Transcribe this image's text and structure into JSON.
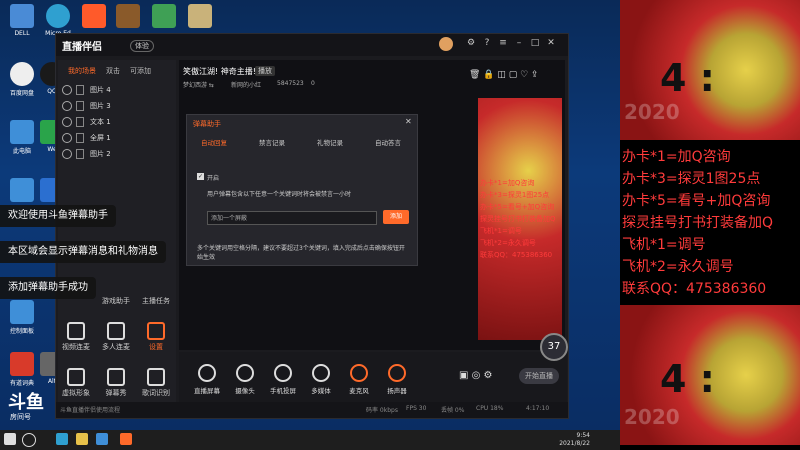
{
  "desktop": {
    "icons": [
      "DELL",
      "Micro Ed",
      "",
      "",
      "",
      "",
      "",
      "百度网盘",
      "QQ",
      "此电脑",
      "We",
      "",
      "",
      "控制面板",
      "有道词典",
      "Alt"
    ]
  },
  "app": {
    "brand": "直播伴侣",
    "tag": "体验",
    "left_tabs": [
      "我的场景",
      "双击",
      "可添加"
    ],
    "sources": [
      {
        "label": "图片 4"
      },
      {
        "label": "图片 3"
      },
      {
        "label": "文本 1"
      },
      {
        "label": "全屏 1"
      },
      {
        "label": "图片 2"
      }
    ],
    "tools": [
      {
        "label": "游戏助手"
      },
      {
        "label": "主播任务"
      },
      {
        "label": "视频连麦"
      },
      {
        "label": "多人连麦"
      },
      {
        "label": "设置"
      },
      {
        "label": "虚拟形象"
      },
      {
        "label": "弹幕秀"
      },
      {
        "label": "歌词识别"
      }
    ],
    "preview_title": "笑傲江湖! 神奇主播!",
    "preview_badge": "播放",
    "preview_meta": [
      "梦幻西游 ⇆",
      "新网的小红",
      "5847523",
      "0"
    ],
    "dialog": {
      "title": "弹幕助手",
      "tabs": [
        "自动回复",
        "禁言记录",
        "礼物记录",
        "自动答言"
      ],
      "checkbox_label": "开启",
      "desc": "用户弹幕包含以下任意一个关键词时将会被禁言一小时",
      "input_placeholder": "添加一个屏蔽",
      "add_button": "添加",
      "footer": "多个关键词用空格分隔，建议不要超过3个关键词，填入完成后点击确保按钮开始生效"
    },
    "bottom_buttons": [
      "直播屏幕",
      "摄像头",
      "手机投屏",
      "多媒体",
      "麦克风",
      "扬声器"
    ],
    "go_live": "开始直播",
    "status_bar": "斗鱼直播伴侣使用流程",
    "stats": [
      "码率 0kbps",
      "FPS 30",
      "丢帧 0%",
      "CPU 18%",
      "4:17:10"
    ]
  },
  "toasts": [
    "欢迎使用斗鱼弹幕助手",
    "本区域会显示弹幕消息和礼物消息",
    "添加弹幕助手成功"
  ],
  "logo": {
    "main": "斗鱼",
    "sub": "房间号"
  },
  "bubble": "37",
  "taskbar": {
    "time": "9:54",
    "date": "2021/8/22"
  },
  "overlay": {
    "score": "4 :",
    "year": "2020",
    "promo_lines": [
      "办卡*1=加Q咨询",
      "办卡*3=探灵1图25点",
      "办卡*5=看号+加Q咨询",
      "探灵挂号打书打装备加Q",
      "飞机*1=调号",
      "飞机*2=永久调号",
      "联系QQ：475386360"
    ]
  },
  "mini": {
    "lines": [
      "办卡*1=加Q咨询",
      "办卡*3=探灵1图25点",
      "办卡*5=看号+加Q咨询",
      "探灵挂号打书打装备加Q",
      "飞机*1=调号",
      "飞机*2=永久调号",
      "联系QQ：475386360"
    ]
  },
  "colors": {
    "accent": "#ff6a2a",
    "promo": "#ff3b3b"
  }
}
